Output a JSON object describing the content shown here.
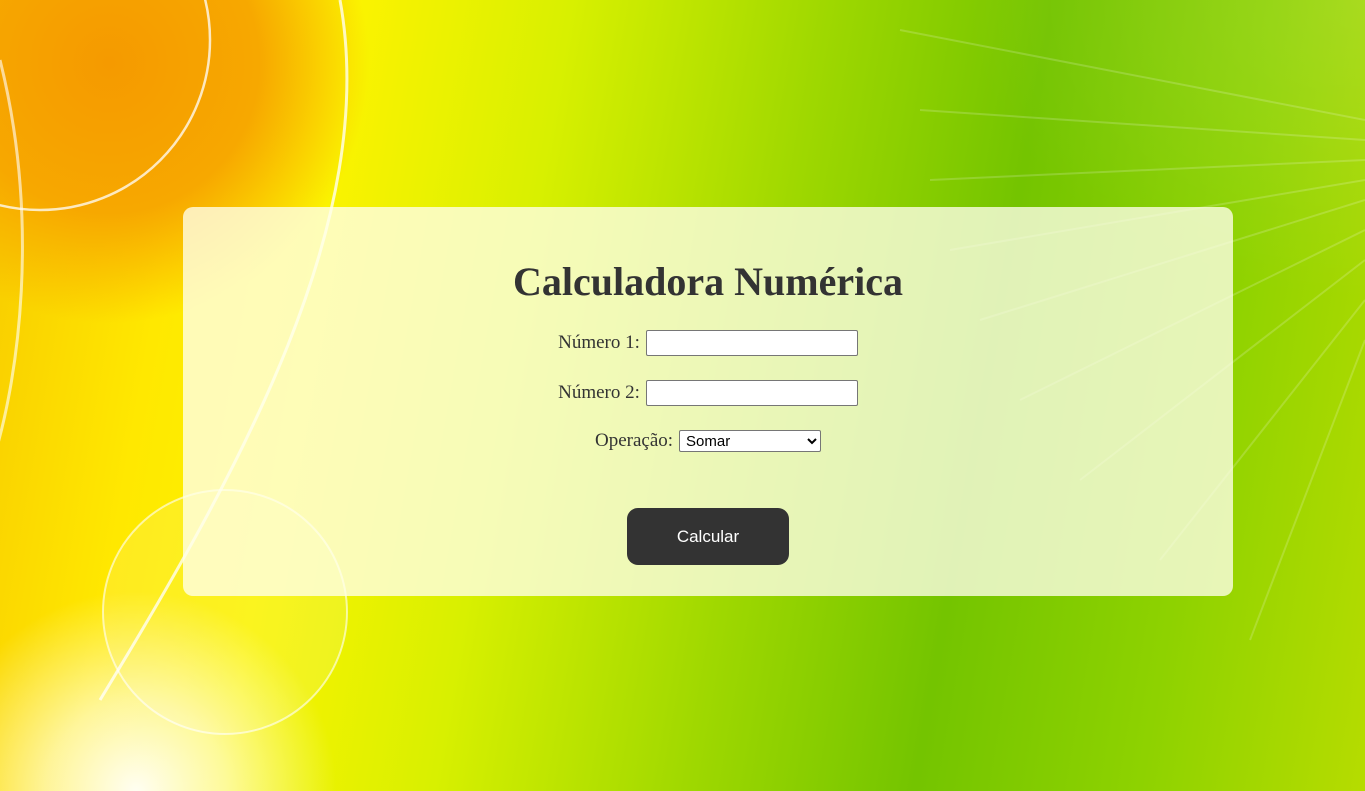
{
  "app": {
    "title": "Calculadora Numérica"
  },
  "form": {
    "numero1": {
      "label": "Número 1:",
      "value": "",
      "placeholder": ""
    },
    "numero2": {
      "label": "Número 2:",
      "value": "",
      "placeholder": ""
    },
    "operacao": {
      "label": "Operação:",
      "selected": "Somar"
    },
    "calcular_label": "Calcular"
  },
  "colors": {
    "text": "#333333",
    "button_bg": "#333333",
    "button_text": "#ffffff",
    "card_bg": "#fffff0"
  }
}
